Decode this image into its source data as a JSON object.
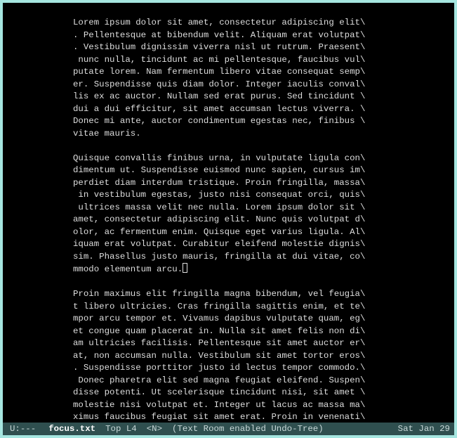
{
  "paragraphs": [
    {
      "lines": [
        "Lorem ipsum dolor sit amet, consectetur adipiscing elit\\",
        ". Pellentesque at bibendum velit. Aliquam erat volutpat\\",
        ". Vestibulum dignissim viverra nisl ut rutrum. Praesent\\",
        " nunc nulla, tincidunt ac mi pellentesque, faucibus vul\\",
        "putate lorem. Nam fermentum libero vitae consequat semp\\",
        "er. Suspendisse quis diam dolor. Integer iaculis conval\\",
        "lis ex ac auctor. Nullam sed erat purus. Sed tincidunt \\",
        "dui a dui efficitur, sit amet accumsan lectus viverra. \\",
        "Donec mi ante, auctor condimentum egestas nec, finibus \\",
        "vitae mauris."
      ],
      "cursor_after": false
    },
    {
      "lines": [
        "Quisque convallis finibus urna, in vulputate ligula con\\",
        "dimentum ut. Suspendisse euismod nunc sapien, cursus im\\",
        "perdiet diam interdum tristique. Proin fringilla, massa\\",
        " in vestibulum egestas, justo nisi consequat orci, quis\\",
        " ultrices massa velit nec nulla. Lorem ipsum dolor sit \\",
        "amet, consectetur adipiscing elit. Nunc quis volutpat d\\",
        "olor, ac fermentum enim. Quisque eget varius ligula. Al\\",
        "iquam erat volutpat. Curabitur eleifend molestie dignis\\",
        "sim. Phasellus justo mauris, fringilla at dui vitae, co\\",
        "mmodo elementum arcu."
      ],
      "cursor_after": true
    },
    {
      "lines": [
        "Proin maximus elit fringilla magna bibendum, vel feugia\\",
        "t libero ultricies. Cras fringilla sagittis enim, et te\\",
        "mpor arcu tempor et. Vivamus dapibus vulputate quam, eg\\",
        "et congue quam placerat in. Nulla sit amet felis non di\\",
        "am ultricies facilisis. Pellentesque sit amet auctor er\\",
        "at, non accumsan nulla. Vestibulum sit amet tortor eros\\",
        ". Suspendisse porttitor justo id lectus tempor commodo.\\",
        " Donec pharetra elit sed magna feugiat eleifend. Suspen\\",
        "disse potenti. Ut scelerisque tincidunt nisi, sit amet \\",
        "molestie nisi volutpat et. Integer ut lacus ac massa ma\\",
        "ximus faucibus feugiat sit amet erat. Proin in venenati\\"
      ],
      "cursor_after": false
    }
  ],
  "modeline": {
    "left_marker": "U:---",
    "buffer_name": "focus.txt",
    "position": "Top L4",
    "mode_short": "<N>",
    "minor_modes": "(Text Room enabled Undo-Tree)",
    "date": "Sat Jan 29"
  }
}
